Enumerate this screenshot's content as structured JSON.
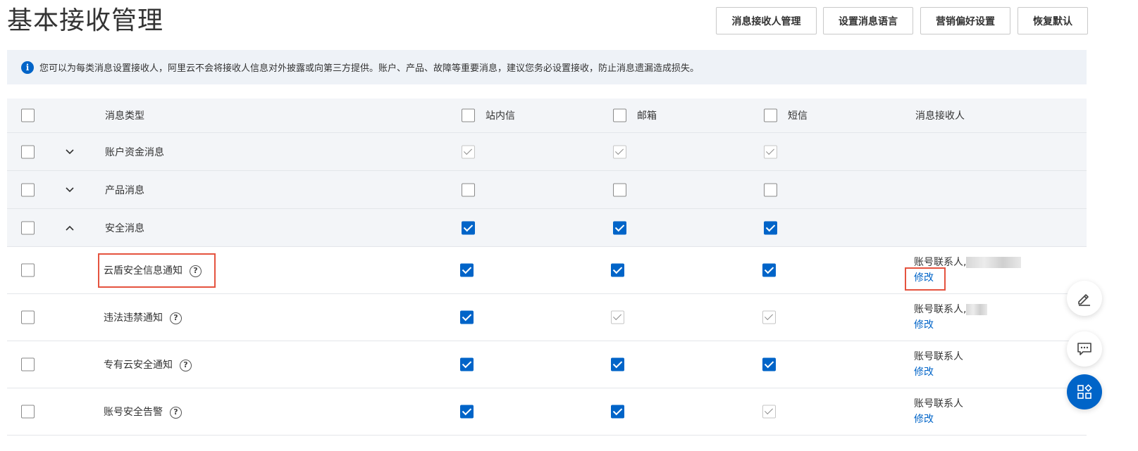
{
  "page": {
    "title": "基本接收管理"
  },
  "header_buttons": [
    {
      "label": "消息接收人管理"
    },
    {
      "label": "设置消息语言"
    },
    {
      "label": "营销偏好设置"
    },
    {
      "label": "恢复默认"
    }
  ],
  "notice": {
    "icon": "info-icon",
    "icon_glyph": "i",
    "text": "您可以为每类消息设置接收人，阿里云不会将接收人信息对外披露或向第三方提供。账户、产品、故障等重要消息，建议您务必设置接收，防止消息遗漏造成损失。"
  },
  "table": {
    "columns": {
      "type": "消息类型",
      "inbox": "站内信",
      "email": "邮箱",
      "sms": "短信",
      "receiver": "消息接收人"
    },
    "header_checks": {
      "select_all": false,
      "inbox": false,
      "email": false,
      "sms": false
    },
    "groups": [
      {
        "label": "账户资金消息",
        "expanded": false,
        "checked": false,
        "inbox": "grey",
        "email": "grey",
        "sms": "grey"
      },
      {
        "label": "产品消息",
        "expanded": false,
        "checked": false,
        "inbox": "empty",
        "email": "empty",
        "sms": "empty"
      },
      {
        "label": "安全消息",
        "expanded": true,
        "checked": false,
        "inbox": "checked",
        "email": "checked",
        "sms": "checked"
      }
    ],
    "children": [
      {
        "label": "云盾安全信息通知",
        "help_glyph": "?",
        "checked": false,
        "inbox": "checked",
        "email": "checked",
        "sms": "checked",
        "receiver": "账号联系人,",
        "receiver_masked": true,
        "edit": "修改",
        "highlighted": true
      },
      {
        "label": "违法违禁通知",
        "help_glyph": "?",
        "checked": false,
        "inbox": "checked",
        "email": "grey",
        "sms": "grey",
        "receiver": "账号联系人,",
        "receiver_masked": true,
        "edit": "修改",
        "highlighted": false
      },
      {
        "label": "专有云安全通知",
        "help_glyph": "?",
        "checked": false,
        "inbox": "checked",
        "email": "checked",
        "sms": "checked",
        "receiver": "账号联系人",
        "receiver_masked": false,
        "edit": "修改",
        "highlighted": false
      },
      {
        "label": "账号安全告警",
        "help_glyph": "?",
        "checked": false,
        "inbox": "checked",
        "email": "checked",
        "sms": "grey",
        "receiver": "账号联系人",
        "receiver_masked": false,
        "edit": "修改",
        "highlighted": false
      }
    ]
  },
  "floating_tools": [
    {
      "icon": "edit-icon"
    },
    {
      "icon": "chat-icon"
    },
    {
      "icon": "apps-icon"
    }
  ],
  "colors": {
    "primary": "#0064c8",
    "highlight_border": "#e5533f",
    "header_bg": "#f3f5f8",
    "notice_bg": "#eef2f7"
  }
}
